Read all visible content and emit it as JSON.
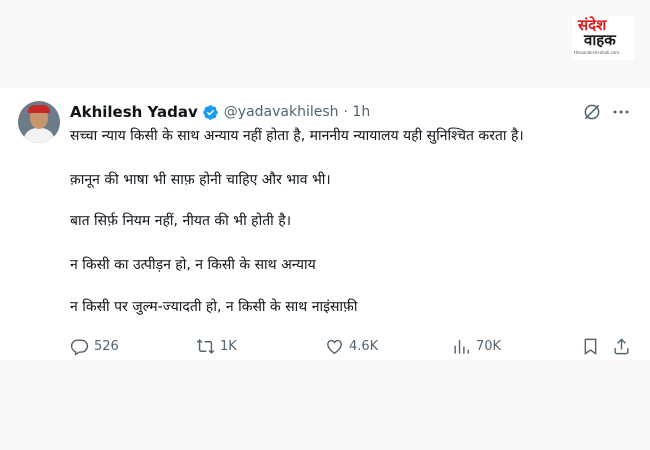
{
  "watermark": {
    "top": "संदेश",
    "bottom": "वाहक",
    "url": "thesandeshvahak.com"
  },
  "tweet": {
    "author_name": "Akhilesh Yadav",
    "handle": "@yadavakhilesh",
    "time": "· 1h",
    "lines": [
      "सच्चा न्याय किसी के साथ अन्याय नहीं होता है, माननीय न्यायालय यही सुनिश्चित करता है।",
      "क़ानून की भाषा भी साफ़ होनी चाहिए और भाव भी।",
      "बात सिर्फ़ नियम नहीं, नीयत की भी होती है।",
      "न किसी का उत्पीड़न हो, न किसी के साथ अन्याय",
      "न किसी पर जुल्म-ज्यादती हो, न किसी के साथ नाइंसाफ़ी"
    ],
    "stats": {
      "replies": "526",
      "reposts": "1K",
      "likes": "4.6K",
      "views": "70K"
    }
  },
  "icons": {
    "verified": "verified-badge-icon",
    "grok": "grok-icon",
    "more": "more-icon",
    "reply": "reply-icon",
    "repost": "repost-icon",
    "like": "like-icon",
    "views": "views-icon",
    "bookmark": "bookmark-icon",
    "share": "share-icon"
  },
  "colors": {
    "verified": "#1d9bf0",
    "muted": "#536471",
    "brand_red": "#d81b1b"
  }
}
